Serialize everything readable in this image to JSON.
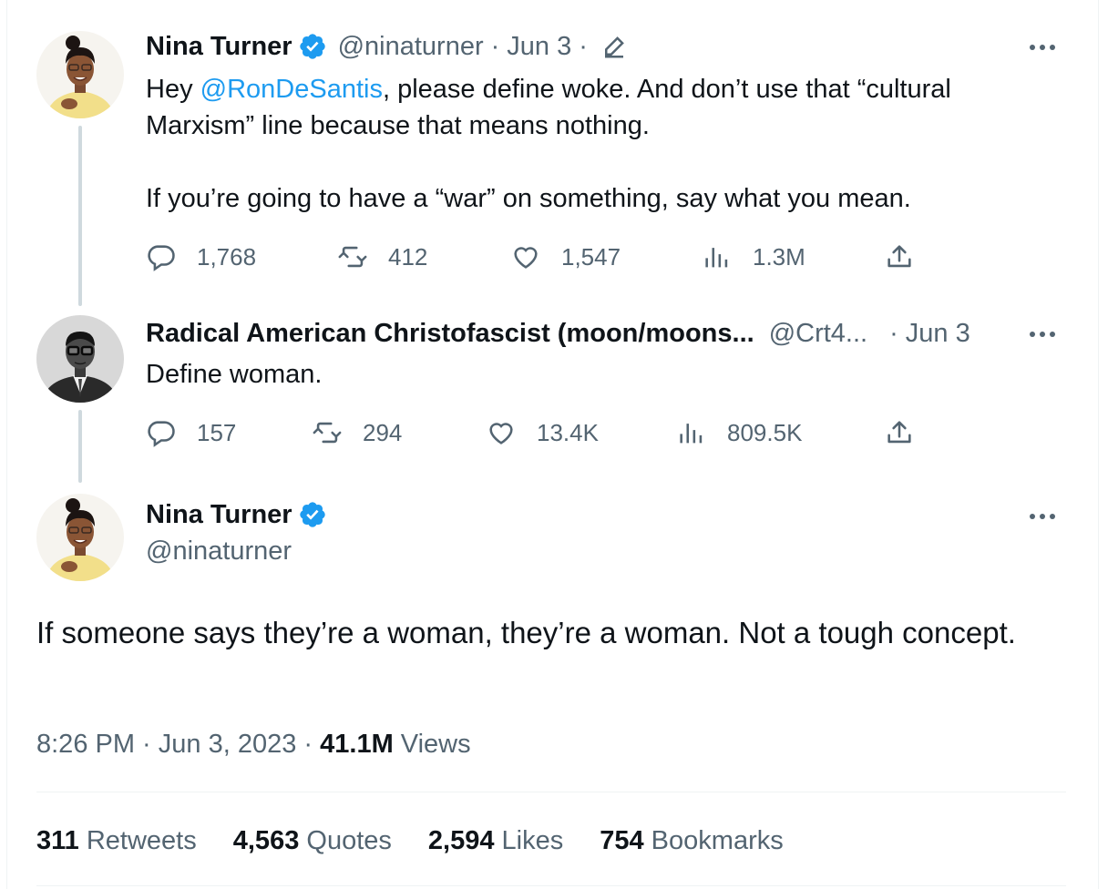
{
  "tweet1": {
    "name": "Nina Turner",
    "handle": "@ninaturner",
    "date": "Jun 3",
    "dot": "·",
    "text_before": "Hey ",
    "mention": "@RonDeSantis",
    "text_after": ", please define woke. And don’t use that “cultural Marxism” line because that means nothing.",
    "text_p2": "If you’re going to have a “war” on something, say what you mean.",
    "replies": "1,768",
    "retweets": "412",
    "likes": "1,547",
    "views": "1.3M"
  },
  "tweet2": {
    "name": "Radical American Christofascist (moon/moons...",
    "handle": "@Crt4...",
    "date": "· Jun 3",
    "text": "Define woman.",
    "replies": "157",
    "retweets": "294",
    "likes": "13.4K",
    "views": "809.5K"
  },
  "main": {
    "name": "Nina Turner",
    "handle": "@ninaturner",
    "text": "If someone says they’re a woman, they’re a woman. Not a tough concept.",
    "time": "8:26 PM · Jun 3, 2023 · ",
    "views_count": "41.1M",
    "views_label": " Views",
    "stats": [
      {
        "count": "311",
        "label": " Retweets"
      },
      {
        "count": "4,563",
        "label": " Quotes"
      },
      {
        "count": "2,594",
        "label": " Likes"
      },
      {
        "count": "754",
        "label": " Bookmarks"
      }
    ]
  },
  "colors": {
    "accent": "#1d9bf0",
    "muted": "#536471",
    "text": "#0f1419",
    "divider": "#eff3f4",
    "thread_line": "#cfd9de"
  },
  "icons": [
    "verified-badge-icon",
    "edit-pencil-icon",
    "more-dots-icon",
    "reply-icon",
    "retweet-icon",
    "like-icon",
    "views-icon",
    "share-icon"
  ]
}
